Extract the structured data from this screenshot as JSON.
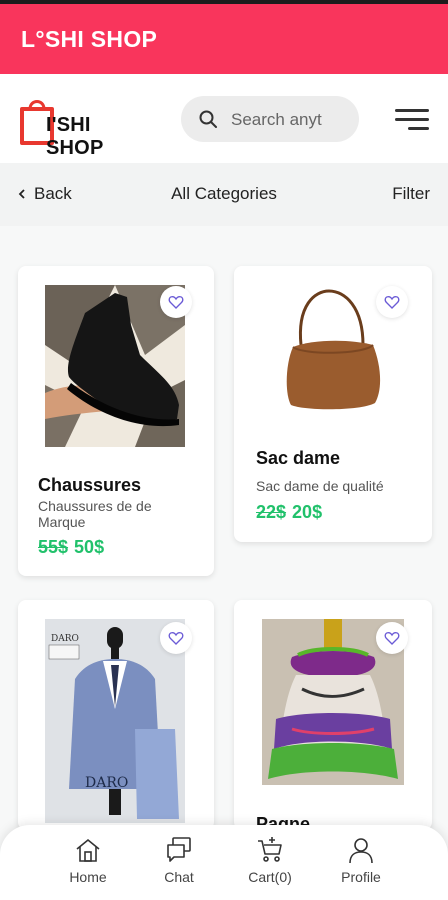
{
  "app": {
    "title": "L°SHI SHOP"
  },
  "header": {
    "logo_text": "I'SHI SHOP",
    "search_placeholder": "Search anyt"
  },
  "subnav": {
    "back_label": "Back",
    "title": "All Categories",
    "filter_label": "Filter"
  },
  "products": [
    {
      "name": "Chaussures",
      "description": "Chaussures de de Marque",
      "old_price": "55$",
      "price": "50$"
    },
    {
      "name": "Sac dame",
      "description": "Sac dame de qualité",
      "old_price": "22$",
      "price": "20$"
    },
    {
      "image_text_top": "DARO",
      "image_text_brand": "DARO"
    },
    {
      "name": "Pagne"
    }
  ],
  "bottom_nav": {
    "items": [
      {
        "label": "Home",
        "icon": "home-icon"
      },
      {
        "label": "Chat",
        "icon": "chat-icon"
      },
      {
        "label": "Cart(0)",
        "icon": "cart-icon"
      },
      {
        "label": "Profile",
        "icon": "profile-icon"
      }
    ]
  },
  "colors": {
    "brand": "#f9355c",
    "price": "#21c16b",
    "heart": "#6b5bd6"
  }
}
